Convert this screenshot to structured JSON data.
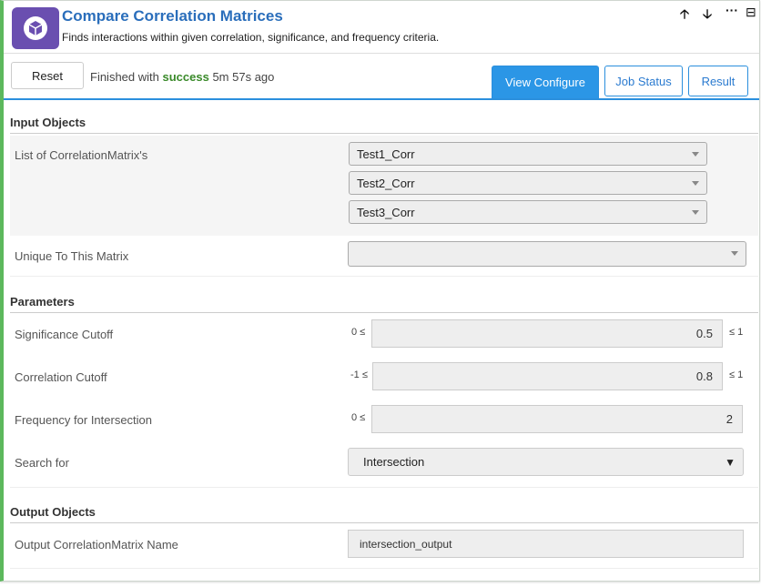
{
  "header": {
    "title": "Compare Correlation Matrices",
    "subtitle": "Finds interactions within given correlation, significance, and frequency criteria.",
    "controls": [
      "🡡",
      "🡣",
      "···",
      "⊟"
    ]
  },
  "toolbar": {
    "reset_label": "Reset",
    "status_prefix": "Finished with",
    "status_word": "success",
    "status_suffix": "5m 57s ago",
    "tabs": {
      "configure": "View Configure",
      "job_status": "Job Status",
      "result": "Result"
    }
  },
  "input_objects": {
    "heading": "Input Objects",
    "list_label": "List of CorrelationMatrix's",
    "list_values": [
      "Test1_Corr",
      "Test2_Corr",
      "Test3_Corr"
    ],
    "unique_label": "Unique To This Matrix",
    "unique_value": ""
  },
  "parameters": {
    "heading": "Parameters",
    "significance": {
      "label": "Significance Cutoff",
      "min": "0 ≤",
      "max": "≤ 1",
      "value": "0.5"
    },
    "correlation": {
      "label": "Correlation Cutoff",
      "min": "-1 ≤",
      "max": "≤ 1",
      "value": "0.8"
    },
    "frequency": {
      "label": "Frequency for Intersection",
      "min": "0 ≤",
      "value": "2"
    },
    "search_for": {
      "label": "Search for",
      "value": "Intersection"
    }
  },
  "output_objects": {
    "heading": "Output Objects",
    "name_label": "Output CorrelationMatrix Name",
    "name_value": "intersection_output"
  },
  "colors": {
    "accent": "#2b96e6",
    "success": "#3a8a2a",
    "icon_bg": "#6a4fb0",
    "left_bar": "#5cb85c"
  }
}
